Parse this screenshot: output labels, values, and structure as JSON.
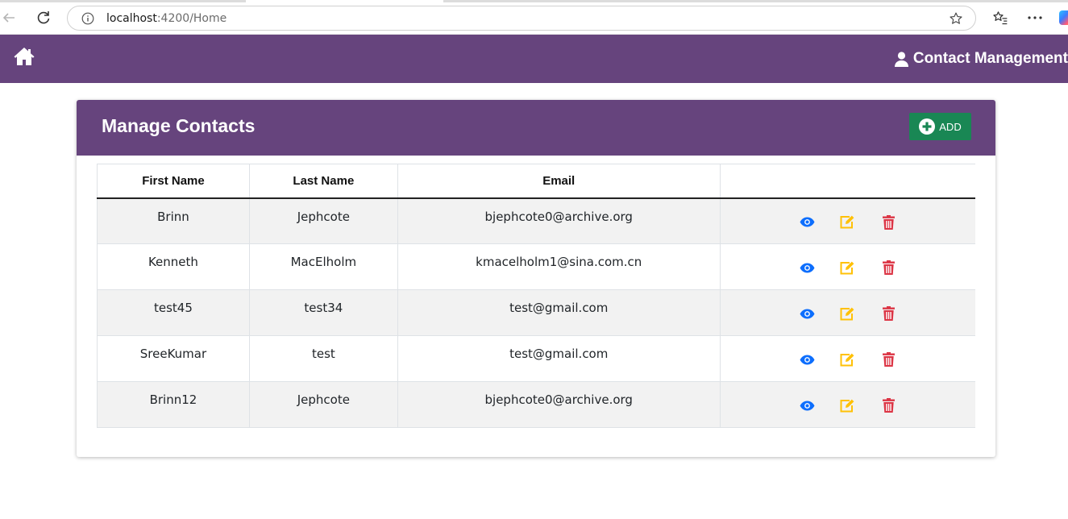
{
  "browser": {
    "url_host": "localhost",
    "url_path": ":4200/Home"
  },
  "navbar": {
    "brand_label": "Contact Management",
    "bg_color": "#66447d"
  },
  "card": {
    "title": "Manage Contacts",
    "add_label": "ADD",
    "add_color": "#198754"
  },
  "table": {
    "headers": {
      "first_name": "First Name",
      "last_name": "Last Name",
      "email": "Email",
      "actions": ""
    },
    "rows": [
      {
        "first_name": "Brinn",
        "last_name": "Jephcote",
        "email": "bjephcote0@archive.org"
      },
      {
        "first_name": "Kenneth",
        "last_name": "MacElholm",
        "email": "kmacelholm1@sina.com.cn"
      },
      {
        "first_name": "test45",
        "last_name": "test34",
        "email": "test@gmail.com"
      },
      {
        "first_name": "SreeKumar",
        "last_name": "test",
        "email": "test@gmail.com"
      },
      {
        "first_name": "Brinn12",
        "last_name": "Jephcote",
        "email": "bjephcote0@archive.org"
      }
    ],
    "action_icons": {
      "view": "eye-icon",
      "edit": "edit-icon",
      "delete": "trash-icon"
    },
    "action_colors": {
      "view": "#0d6efd",
      "edit": "#ffc107",
      "delete": "#dc3545"
    }
  }
}
